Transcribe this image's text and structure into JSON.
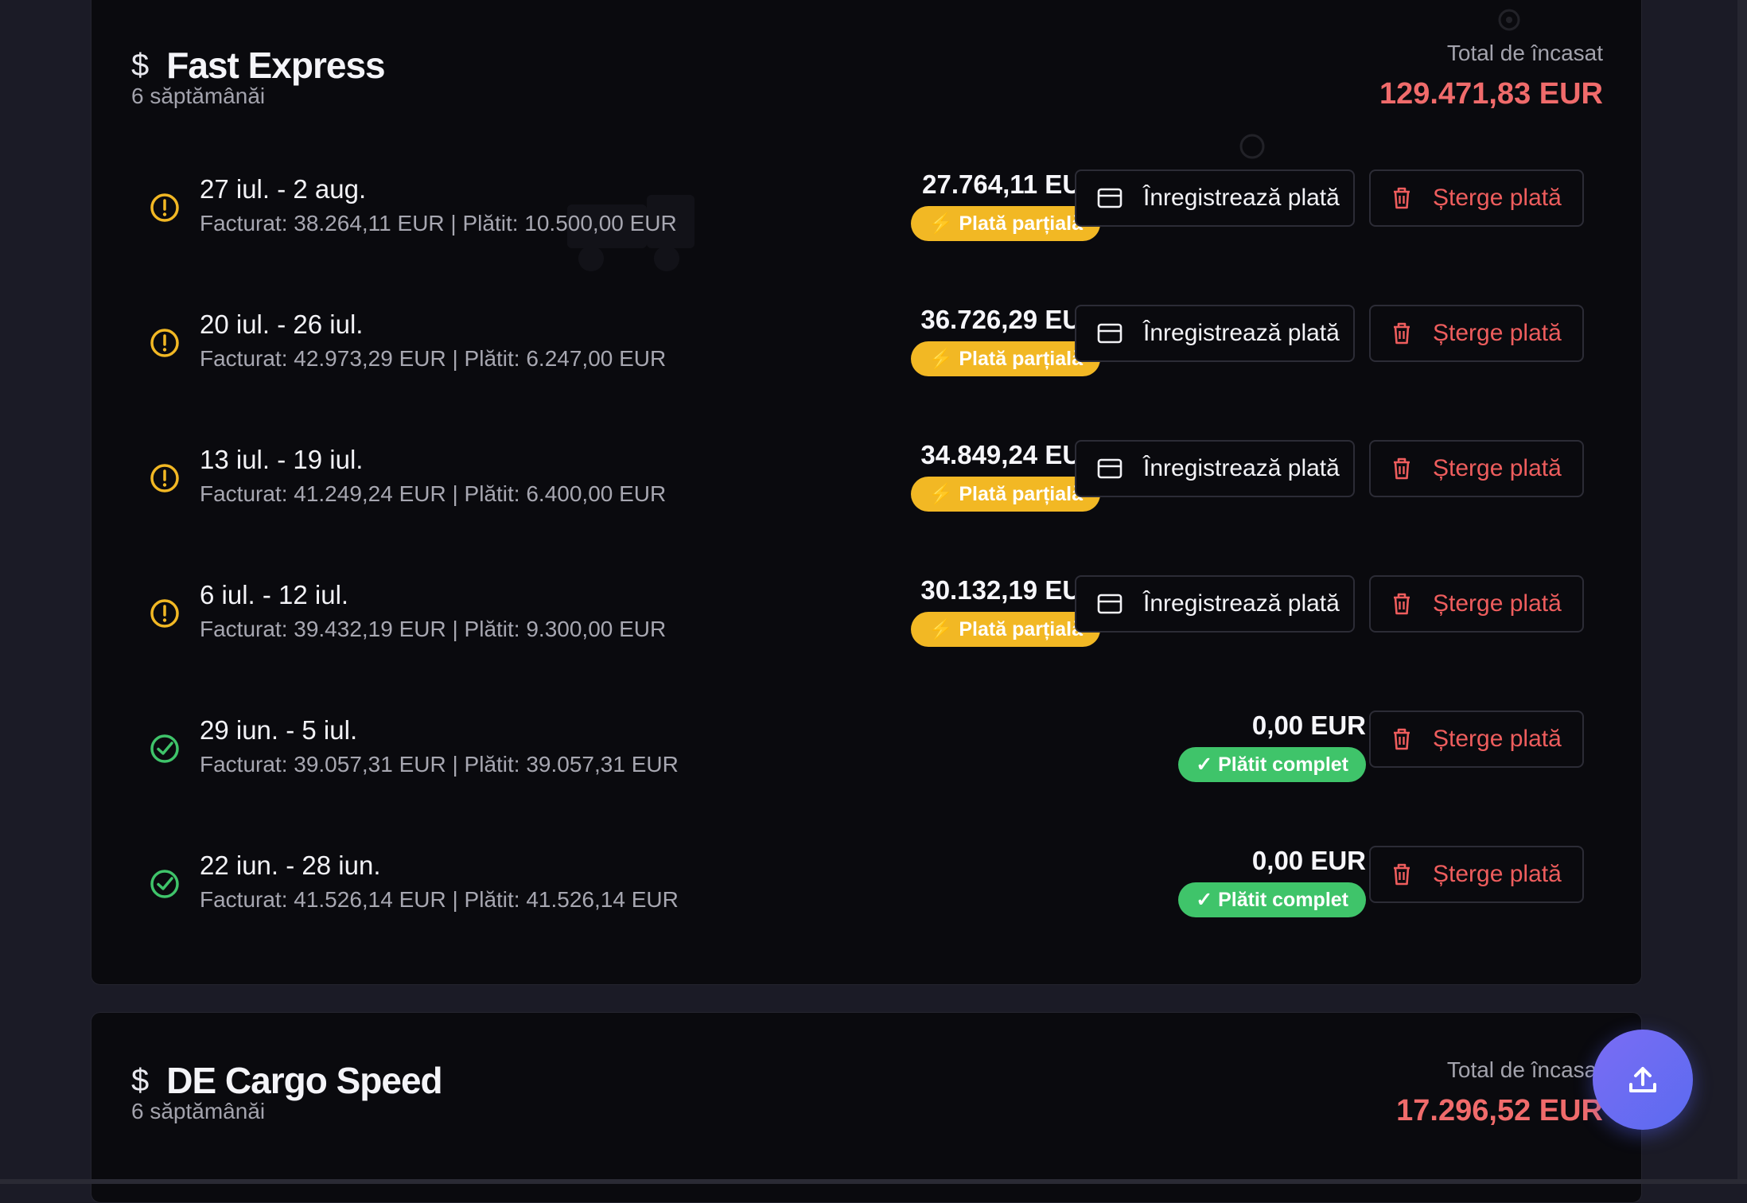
{
  "cards": [
    {
      "name": "Fast Express",
      "weeks": "6 săptămânăi",
      "total_label": "Total de încasat",
      "total_value": "129.471,83 EUR",
      "rows": [
        {
          "period": "27 iul. - 2 aug.",
          "details": "Facturat: 38.264,11 EUR | Plătit: 10.500,00 EUR",
          "amount": "27.764,11 EUR",
          "status": "partial",
          "badge": "⚡ Plată parțială",
          "register": "Înregistrează plată",
          "delete": "Șterge plată"
        },
        {
          "period": "20 iul. - 26 iul.",
          "details": "Facturat: 42.973,29 EUR | Plătit: 6.247,00 EUR",
          "amount": "36.726,29 EUR",
          "status": "partial",
          "badge": "⚡ Plată parțială",
          "register": "Înregistrează plată",
          "delete": "Șterge plată"
        },
        {
          "period": "13 iul. - 19 iul.",
          "details": "Facturat: 41.249,24 EUR | Plătit: 6.400,00 EUR",
          "amount": "34.849,24 EUR",
          "status": "partial",
          "badge": "⚡ Plată parțială",
          "register": "Înregistrează plată",
          "delete": "Șterge plată"
        },
        {
          "period": "6 iul. - 12 iul.",
          "details": "Facturat: 39.432,19 EUR | Plătit: 9.300,00 EUR",
          "amount": "30.132,19 EUR",
          "status": "partial",
          "badge": "⚡ Plată parțială",
          "register": "Înregistrează plată",
          "delete": "Șterge plată"
        },
        {
          "period": "29 iun. - 5 iul.",
          "details": "Facturat: 39.057,31 EUR | Plătit: 39.057,31 EUR",
          "amount": "0,00 EUR",
          "status": "full",
          "badge": "✓ Plătit complet",
          "delete": "Șterge plată"
        },
        {
          "period": "22 iun. - 28 iun.",
          "details": "Facturat: 41.526,14 EUR | Plătit: 41.526,14 EUR",
          "amount": "0,00 EUR",
          "status": "full",
          "badge": "✓ Plătit complet",
          "delete": "Șterge plată"
        }
      ]
    },
    {
      "name": "DE Cargo Speed",
      "weeks": "6 săptămânăi",
      "total_label": "Total de încasat",
      "total_value": "17.296,52 EUR"
    }
  ],
  "icons": {
    "currency": "dollar-icon",
    "partial": "alert-circle-icon",
    "full": "check-circle-icon",
    "register": "credit-card-icon",
    "delete": "trash-icon",
    "fab": "upload-icon"
  },
  "colors": {
    "background": "#1b1b26",
    "card": "#0a0a0e",
    "total": "#f06b6b",
    "partial": "#f2b824",
    "full": "#3fc46a",
    "delete": "#ee5d5d",
    "fab": "#6b6cf2"
  }
}
